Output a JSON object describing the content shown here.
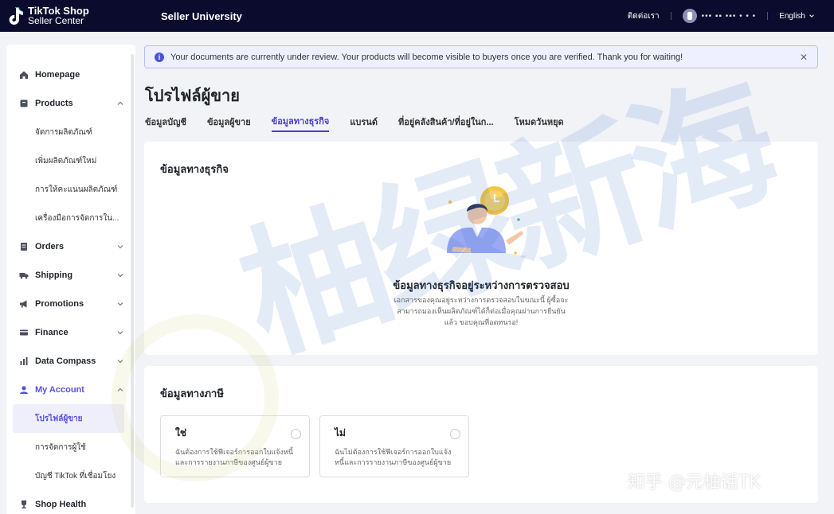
{
  "topbar": {
    "brand_line1": "TikTok Shop",
    "brand_line2": "Seller Center",
    "title": "Seller University",
    "contact": "ติดต่อเรา",
    "account_name": "••• ▪▪ •▪• • • •",
    "language": "English"
  },
  "sidebar": {
    "items": [
      {
        "label": "Homepage",
        "icon": "home-icon"
      },
      {
        "label": "Products",
        "icon": "box-icon"
      },
      {
        "label": "จัดการผลิตภัณฑ์"
      },
      {
        "label": "เพิ่มผลิตภัณฑ์ใหม่"
      },
      {
        "label": "การให้คะแนนผลิตภัณฑ์"
      },
      {
        "label": "เครื่องมือการจัดการใน..."
      },
      {
        "label": "Orders",
        "icon": "orders-icon"
      },
      {
        "label": "Shipping",
        "icon": "truck-icon"
      },
      {
        "label": "Promotions",
        "icon": "megaphone-icon"
      },
      {
        "label": "Finance",
        "icon": "finance-icon"
      },
      {
        "label": "Data Compass",
        "icon": "chart-icon"
      },
      {
        "label": "My Account",
        "icon": "user-icon"
      },
      {
        "label": "โปรไฟล์ผู้ขาย"
      },
      {
        "label": "การจัดการผู้ใช้"
      },
      {
        "label": "บัญชี TikTok ที่เชื่อมโยง"
      },
      {
        "label": "Shop Health",
        "icon": "trophy-icon"
      }
    ]
  },
  "banner": {
    "text": "Your documents are currently under review. Your products will become visible to buyers once you are verified. Thank you for waiting!"
  },
  "page": {
    "title": "โปรไฟล์ผู้ขาย",
    "tabs": [
      "ข้อมูลบัญชี",
      "ข้อมูลผู้ขาย",
      "ข้อมูลทางธุรกิจ",
      "แบรนด์",
      "ที่อยู่คลังสินค้า/ที่อยู่ในก...",
      "โหมดวันหยุด"
    ]
  },
  "business": {
    "title": "ข้อมูลทางธุรกิจ",
    "review_title": "ข้อมูลทางธุรกิจอยู่ระหว่างการตรวจสอบ",
    "review_desc": "เอกสารของคุณอยู่ระหว่างการตรวจสอบในขณะนี้ ผู้ซื้อจะสามารถมองเห็นผลิตภัณฑ์ได้ก็ต่อเมื่อคุณผ่านการยืนยันแล้ว ขอบคุณที่อดทนรอ!"
  },
  "tax": {
    "title": "ข้อมูลทางภาษี",
    "options": [
      {
        "title": "ใช่",
        "desc": "ฉันต้องการใช้ฟีเจอร์การออกใบแจ้งหนี้และการรายงานภาษีของศูนย์ผู้ขาย"
      },
      {
        "title": "ไม่",
        "desc": "ฉันไม่ต้องการใช้ฟีเจอร์การออกใบแจ้งหนี้และการรายงานภาษีของศูนย์ผู้ขาย"
      }
    ]
  },
  "watermark": {
    "big": "柚绿新海",
    "bottom": "知乎 @元柚话TK"
  },
  "colors": {
    "accent": "#5850e6",
    "topbar": "#0b0b2d",
    "banner_bg": "#eef0ff"
  }
}
